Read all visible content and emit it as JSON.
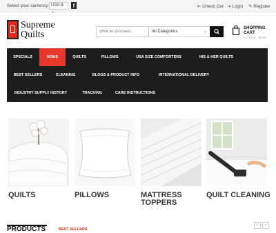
{
  "topbar": {
    "currency_label": "Select your currency:",
    "currency_value": "USD $ ⌄",
    "facebook_glyph": "f",
    "checkout": "⇤ Check Out",
    "login": "⇥ Login",
    "register": "✎ Register"
  },
  "logo": {
    "line1": "Supreme",
    "line2": "Quilts"
  },
  "search": {
    "placeholder": "What do you need...",
    "category": "All Categories",
    "chevron": "⌄"
  },
  "cart": {
    "line1": "SHOPPING",
    "line2": "CART",
    "summary": "0 ITEMS - $0.00"
  },
  "nav": {
    "specials": "SPECIALS",
    "home": "HOME",
    "quilts": "QUILTS",
    "pillows": "PILLOWS",
    "usa_size": "USA SIZE COMFORTERS",
    "his_her": "HIS & HER QUILTS",
    "best_sellers": "BEST SELLERS",
    "cleaning": "CLEANING",
    "blogs": "BLOGS & PRODUCT INFO",
    "intl": "INTERNATIONAL DELIVERY",
    "industry": "INDUSTRY SUPPLY HISTORY",
    "tracking": "TRACKING",
    "care": "CARE INSTRUCTIONS"
  },
  "categories": {
    "quilts": "QUILTS",
    "pillows": "PILLOWS",
    "mattress_1": "MATTRESS",
    "mattress_2": "TOPPERS",
    "cleaning": "QUILT CLEANING"
  },
  "products": {
    "heading": "PRODUCTS",
    "tab": "BEST SELLERS",
    "prev": "‹",
    "next": "›"
  },
  "colors": {
    "accent": "#e8372b",
    "nav_bg": "#1d1d1d"
  }
}
